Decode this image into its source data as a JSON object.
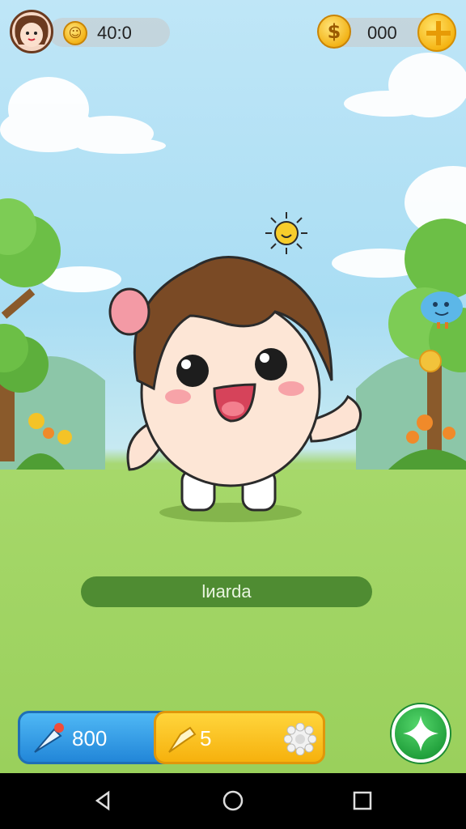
{
  "hud": {
    "left_currency_value": "40:0",
    "right_currency_value": "000"
  },
  "character": {
    "name": "lиarda"
  },
  "actions": {
    "blue_button_value": "800",
    "yellow_button_value": "5"
  },
  "colors": {
    "sky": "#a9ddf3",
    "grass": "#9fd461",
    "name_bar": "#4f8c32",
    "blue_button": "#2286d8",
    "yellow_button": "#f6b10d",
    "green_button": "#1f9e3a"
  },
  "icons": {
    "left_coin": "smiley-coin-icon",
    "right_coin": "dollar-coin-icon",
    "add": "plus-icon",
    "blue_button": "rocket-icon",
    "yellow_button": "hammer-icon",
    "settings": "gear-icon",
    "green_button": "sparkle-icon",
    "nav_back": "back-triangle-icon",
    "nav_home": "home-circle-icon",
    "nav_recent": "recent-square-icon"
  }
}
